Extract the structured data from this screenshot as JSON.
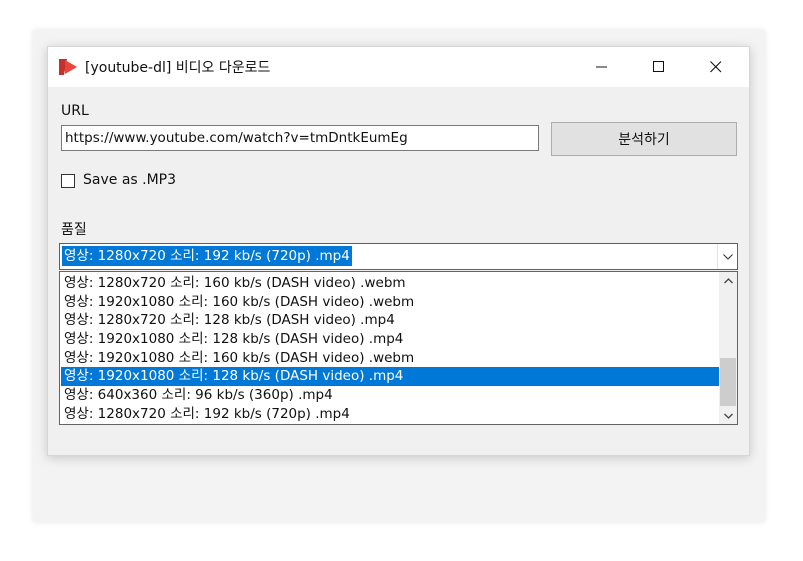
{
  "window": {
    "title": "[youtube-dl]  비디오 다운로드",
    "controls": {
      "minimize": "minimize-icon",
      "maximize": "maximize-icon",
      "close": "close-icon"
    }
  },
  "form": {
    "url_label": "URL",
    "url_value": "https://www.youtube.com/watch?v=tmDntkEumEg",
    "analyze_button": "분석하기",
    "mp3_label": "Save as .MP3",
    "mp3_checked": false,
    "quality_label": "품질",
    "quality_selected": "영상: 1280x720 소리: 192 kb/s (720p) .mp4"
  },
  "dropdown": {
    "items": [
      "영상: 1280x720 소리: 160 kb/s (DASH video) .webm",
      "영상: 1920x1080 소리: 160 kb/s (DASH video) .webm",
      "영상: 1280x720 소리: 128 kb/s (DASH video) .mp4",
      "영상: 1920x1080 소리: 128 kb/s (DASH video) .mp4",
      "영상: 1920x1080 소리: 160 kb/s (DASH video) .webm",
      "영상: 1920x1080 소리: 128 kb/s (DASH video) .mp4",
      "영상: 640x360 소리:  96 kb/s (360p) .mp4",
      "영상: 1280x720 소리: 192 kb/s (720p) .mp4"
    ],
    "highlighted_index": 5
  },
  "colors": {
    "accent": "#0078d7",
    "app_icon": "#e8453c"
  }
}
